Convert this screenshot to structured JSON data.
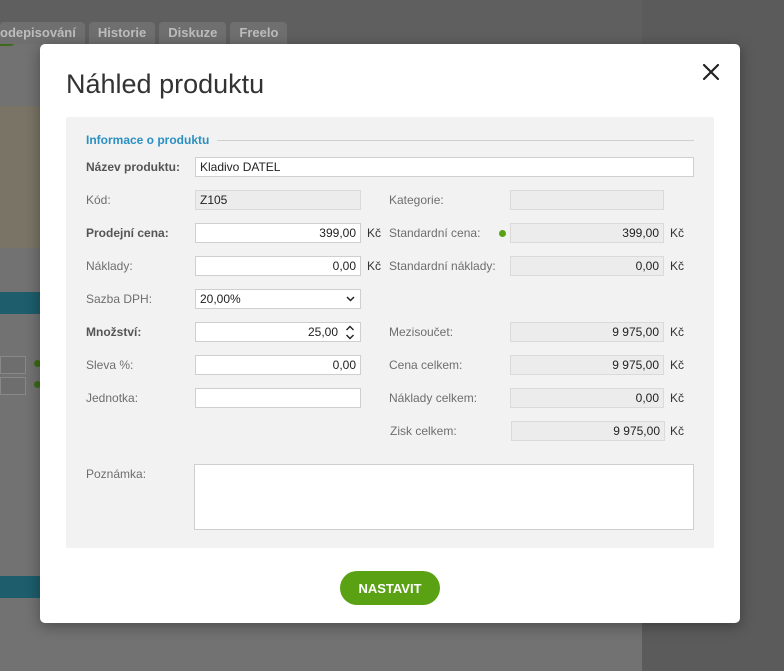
{
  "background": {
    "tabs": [
      "odepisování",
      "Historie",
      "Diskuze",
      "Freelo"
    ]
  },
  "modal": {
    "title": "Náhled produktu",
    "close_icon": "close-icon",
    "section_title": "Informace o produktu",
    "fields": {
      "name": {
        "label": "Název produktu:",
        "value": "Kladivo DATEL"
      },
      "code": {
        "label": "Kód:",
        "value": "Z105"
      },
      "category": {
        "label": "Kategorie:",
        "value": ""
      },
      "sale_price": {
        "label": "Prodejní cena:",
        "value": "399,00",
        "unit": "Kč"
      },
      "standard_price": {
        "label": "Standardní cena:",
        "value": "399,00",
        "unit": "Kč"
      },
      "costs": {
        "label": "Náklady:",
        "value": "0,00",
        "unit": "Kč"
      },
      "standard_costs": {
        "label": "Standardní náklady:",
        "value": "0,00",
        "unit": "Kč"
      },
      "vat_rate": {
        "label": "Sazba DPH:",
        "value": "20,00%"
      },
      "quantity": {
        "label": "Množství:",
        "value": "25,00"
      },
      "subtotal": {
        "label": "Mezisoučet:",
        "value": "9 975,00",
        "unit": "Kč"
      },
      "discount": {
        "label": "Sleva %:",
        "value": "0,00"
      },
      "total_price": {
        "label": "Cena celkem:",
        "value": "9 975,00",
        "unit": "Kč"
      },
      "unit": {
        "label": "Jednotka:",
        "value": ""
      },
      "total_costs": {
        "label": "Náklady celkem:",
        "value": "0,00",
        "unit": "Kč"
      },
      "total_profit": {
        "label": "Zisk celkem:",
        "value": "9 975,00",
        "unit": "Kč"
      },
      "note": {
        "label": "Poznámka:",
        "value": ""
      }
    },
    "submit_label": "NASTAVIT"
  },
  "colors": {
    "accent_green": "#5aa114",
    "section_blue": "#2a8fc2"
  }
}
